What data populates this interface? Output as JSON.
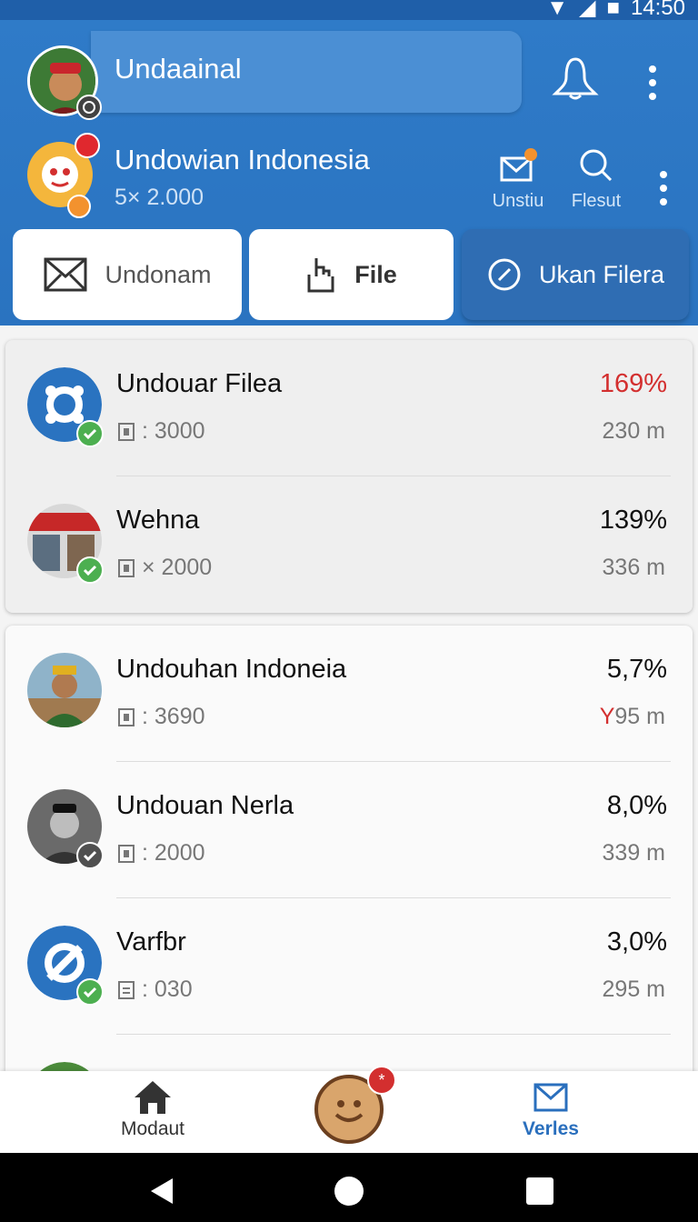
{
  "status_bar": {
    "time": "14:50"
  },
  "account": {
    "name": "Undaainal"
  },
  "channel": {
    "title": "Undowian Indonesia",
    "subtitle": "5× 2.000",
    "actions": [
      {
        "label": "Unstiu",
        "icon": "mail-notification-icon"
      },
      {
        "label": "Flesut",
        "icon": "search-icon"
      }
    ]
  },
  "tabs": [
    {
      "label": "Undonam",
      "icon": "envelope-icon"
    },
    {
      "label": "File",
      "icon": "pointer-icon"
    },
    {
      "label": "Ukan Filera",
      "icon": "edit-circle-icon"
    }
  ],
  "list_top": [
    {
      "title": "Undouar Filea",
      "meta": ": 3000",
      "percent": "169%",
      "distance": "230 m",
      "highlight": true
    },
    {
      "title": "Wehna",
      "meta": "× 2000",
      "percent": "139%",
      "distance": "336 m",
      "highlight": false
    }
  ],
  "list_bottom": [
    {
      "title": "Undouhan Indoneia",
      "meta": ": 3690",
      "percent": "5,7%",
      "distance_prefix": "Y",
      "distance": "95 m"
    },
    {
      "title": "Undouan Nerla",
      "meta": ": 2000",
      "percent": "8,0%",
      "distance_prefix": "",
      "distance": "339 m"
    },
    {
      "title": "Varfbr",
      "meta": ": 030",
      "percent": "3,0%",
      "distance_prefix": "",
      "distance": "295 m"
    }
  ],
  "bottom_nav": {
    "home_label": "Modaut",
    "mail_label": "Verles",
    "fab_badge": "*"
  },
  "colors": {
    "header_blue": "#2f7bc8",
    "accent_red": "#d32f2f",
    "check_green": "#4caf50"
  }
}
